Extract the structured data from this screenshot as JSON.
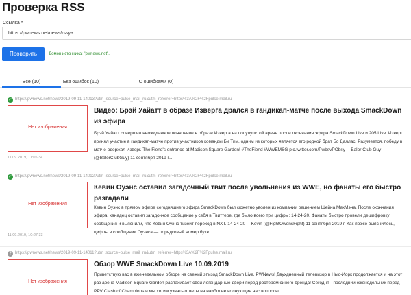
{
  "page": {
    "title": "Проверка RSS"
  },
  "form": {
    "label": "Ссылка *",
    "url_value": "https://pwnews.net/news/rssya",
    "submit_label": "Проверить",
    "source_domain": "Домен источника: \"pwnews.net\"."
  },
  "tabs": [
    {
      "label": "Все (10)",
      "active": true
    },
    {
      "label": "Без ошибок (10)",
      "active": false
    },
    {
      "label": "С ошибками (0)",
      "active": false
    }
  ],
  "items": [
    {
      "status": "ok",
      "url": "https://pwnews.net/news/2019-09-11-14013?utm_source=pulse_mail_ru&utm_referrer=https%3A%2F%2Fpulse.mail.ru",
      "thumb_text": "Нет изображения",
      "date": "11.09.2019, 11:05:34",
      "title": "Видео: Брэй Уайатт в образе Изверга дрался в гандикап-матче после выхода SmackDown из эфира",
      "description": "Брэй Уайатт совершил неожиданное появление в образе Изверга на популупстой арене после окончания эфира SmackDown Live и 205 Live. Изверг принял участие в гандикап-матче против участников команды Би Тим, одним из которых является его родной брат Бо Даллас. Разумеется, победу в матче одержал Изверг. The Fiend's entrance at Madison Square Garden! #TheFiend #WWEMSG pic.twitter.com/PwbsvPObsy— Balor Club Guy (@BalorClubGuy) 11 сентября 2019 г..."
    },
    {
      "status": "ok",
      "url": "https://pwnews.net/news/2019-09-11-14012?utm_source=pulse_mail_ru&utm_referrer=https%3A%2F%2Fpulse.mail.ru",
      "thumb_text": "Нет изображения",
      "date": "11.09.2019, 10:27:33",
      "title": "Кевин Оуэнс оставил загадочный твит после увольнения из WWE, но фанаты его быстро разгадали",
      "description": "Кевин Оуэнс в прямом эфире сегодняшнего эфира SmackDown был сюжетно уволен из компании решением Шейна МакМэна. После окончания эфира, канадец оставил загадочное сообщение у себя в Твиттере, где было всего три цифры: 14-24-20. Фанаты быстро провели дешифровку сообщения и выяснили, что Кевин Оуэнс тизеит переход в NXT. 14-24-20— Kevin (@FightOwensFight) 11 сентября 2019 г. Как позже выяснилось, цифры в сообщении Оуэнса — порядковый номер букв..."
    },
    {
      "status": "unknown",
      "url": "https://pwnews.net/news/2019-09-11-14011?utm_source=pulse_mail_ru&utm_referrer=https%3A%2F%2Fpulse.mail.ru",
      "thumb_text": "Нет изображения",
      "date": "",
      "title": "Обзор WWE SmackDown Live 10.09.2019",
      "description": "Приветствую вас в еженедельном обзоре на свежий эпизод SmackDown Live, PWNews! Двухдневный телевизор в Нью-Йорк продолжается и на этот раз арена Madison Square Garden распахивает свои легендарные двери перед ростером синего бренда! Сегодня - последний еженедельник перед PPV Clash of Champions и мы хотим узнать ответы на наиболее волнующие нас вопросы."
    }
  ]
}
